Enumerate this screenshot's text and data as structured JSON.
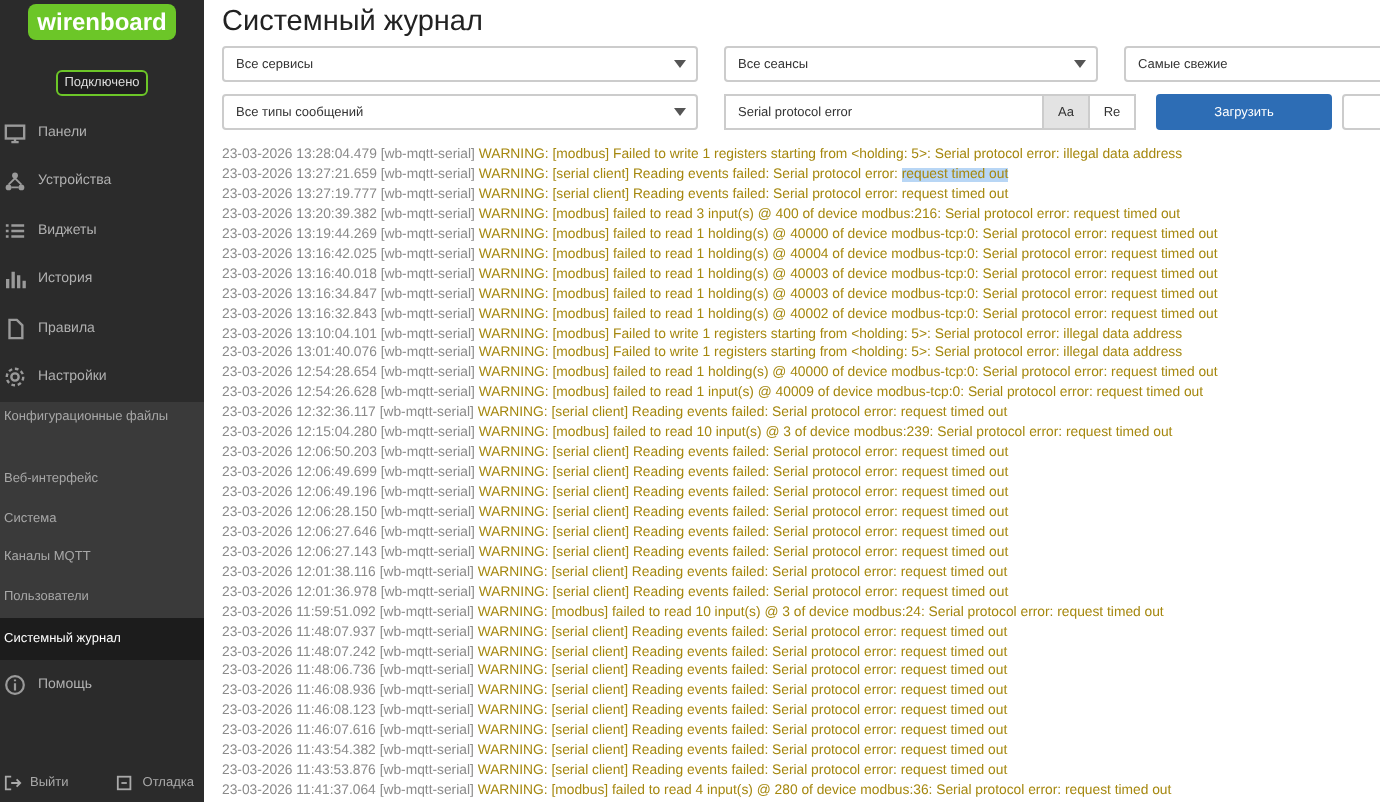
{
  "sidebar": {
    "logo": "wirenboard",
    "status": "Подключено",
    "items": [
      {
        "kind": "nav",
        "label": "Панели",
        "selected": false
      },
      {
        "kind": "nav",
        "label": "Устройства",
        "selected": false
      },
      {
        "kind": "nav",
        "label": "Виджеты",
        "selected": false
      },
      {
        "kind": "nav",
        "label": "История",
        "selected": false
      },
      {
        "kind": "nav",
        "label": "Правила",
        "selected": false
      },
      {
        "kind": "nav",
        "label": "Настройки",
        "selected": false,
        "children": [
          {
            "label": "Конфигурационные файлы",
            "selected": false
          },
          {
            "label": "Веб-интерфейс",
            "selected": false
          },
          {
            "label": "Система",
            "selected": false
          },
          {
            "label": "Каналы MQTT",
            "selected": false
          },
          {
            "label": "Пользователи",
            "selected": false
          },
          {
            "label": "Системный журнал",
            "selected": true
          }
        ]
      },
      {
        "kind": "nav",
        "label": "Помощь",
        "selected": false
      }
    ],
    "footer": [
      "Выйти",
      "Отладка"
    ]
  },
  "page": {
    "title": "Системный журнал"
  },
  "filters": {
    "service": "Все сервисы",
    "session": "Все сеансы",
    "order": "Самые свежие",
    "message_type": "Все типы сообщений",
    "search": {
      "value": "Serial protocol error"
    },
    "toggles": [
      {
        "label": "Aa",
        "selected": true
      },
      {
        "label": "Re",
        "selected": false
      }
    ],
    "load_button": "Загрузить"
  },
  "log": [
    {
      "timestamp": "23-03-2026 13:28:04.479",
      "source": "[wb-mqtt-serial]",
      "message": "WARNING: [modbus] Failed to write 1 registers starting from <holding: 5>: Serial protocol error: illegal data address"
    },
    {
      "timestamp": "23-03-2026 13:27:21.659",
      "source": "[wb-mqtt-serial]",
      "message": "WARNING: [serial client] Reading events failed: Serial protocol error: ",
      "selected_text": "request timed out"
    },
    {
      "timestamp": "23-03-2026 13:27:19.777",
      "source": "[wb-mqtt-serial]",
      "message": "WARNING: [serial client] Reading events failed: Serial protocol error: request timed out"
    },
    {
      "timestamp": "23-03-2026 13:20:39.382",
      "source": "[wb-mqtt-serial]",
      "message": "WARNING: [modbus] failed to read 3 input(s) @ 400 of device modbus:216: Serial protocol error: request timed out"
    },
    {
      "timestamp": "23-03-2026 13:19:44.269",
      "source": "[wb-mqtt-serial]",
      "message": "WARNING: [modbus] failed to read 1 holding(s) @ 40000 of device modbus-tcp:0: Serial protocol error: request timed out"
    },
    {
      "timestamp": "23-03-2026 13:16:42.025",
      "source": "[wb-mqtt-serial]",
      "message": "WARNING: [modbus] failed to read 1 holding(s) @ 40004 of device modbus-tcp:0: Serial protocol error: request timed out"
    },
    {
      "timestamp": "23-03-2026 13:16:40.018",
      "source": "[wb-mqtt-serial]",
      "message": "WARNING: [modbus] failed to read 1 holding(s) @ 40003 of device modbus-tcp:0: Serial protocol error: request timed out"
    },
    {
      "timestamp": "23-03-2026 13:16:34.847",
      "source": "[wb-mqtt-serial]",
      "message": "WARNING: [modbus] failed to read 1 holding(s) @ 40003 of device modbus-tcp:0: Serial protocol error: request timed out"
    },
    {
      "timestamp": "23-03-2026 13:16:32.843",
      "source": "[wb-mqtt-serial]",
      "message": "WARNING: [modbus] failed to read 1 holding(s) @ 40002 of device modbus-tcp:0: Serial protocol error: request timed out"
    },
    {
      "timestamp": "23-03-2026 13:10:04.101",
      "source": "[wb-mqtt-serial]",
      "message": "WARNING: [modbus] Failed to write 1 registers starting from <holding: 5>: Serial protocol error: illegal data address"
    },
    {
      "timestamp": "23-03-2026 13:01:40.076",
      "source": "[wb-mqtt-serial]",
      "message": "WARNING: [modbus] Failed to write 1 registers starting from <holding: 5>: Serial protocol error: illegal data address"
    },
    {
      "timestamp": "23-03-2026 12:54:28.654",
      "source": "[wb-mqtt-serial]",
      "message": "WARNING: [modbus] failed to read 1 holding(s) @ 40000 of device modbus-tcp:0: Serial protocol error: request timed out"
    },
    {
      "timestamp": "23-03-2026 12:54:26.628",
      "source": "[wb-mqtt-serial]",
      "message": "WARNING: [modbus] failed to read 1 input(s) @ 40009 of device modbus-tcp:0: Serial protocol error: request timed out"
    },
    {
      "timestamp": "23-03-2026 12:32:36.117",
      "source": "[wb-mqtt-serial]",
      "message": "WARNING: [serial client] Reading events failed: Serial protocol error: request timed out"
    },
    {
      "timestamp": "23-03-2026 12:15:04.280",
      "source": "[wb-mqtt-serial]",
      "message": "WARNING: [modbus] failed to read 10 input(s) @ 3 of device modbus:239: Serial protocol error: request timed out"
    },
    {
      "timestamp": "23-03-2026 12:06:50.203",
      "source": "[wb-mqtt-serial]",
      "message": "WARNING: [serial client] Reading events failed: Serial protocol error: request timed out"
    },
    {
      "timestamp": "23-03-2026 12:06:49.699",
      "source": "[wb-mqtt-serial]",
      "message": "WARNING: [serial client] Reading events failed: Serial protocol error: request timed out"
    },
    {
      "timestamp": "23-03-2026 12:06:49.196",
      "source": "[wb-mqtt-serial]",
      "message": "WARNING: [serial client] Reading events failed: Serial protocol error: request timed out"
    },
    {
      "timestamp": "23-03-2026 12:06:28.150",
      "source": "[wb-mqtt-serial]",
      "message": "WARNING: [serial client] Reading events failed: Serial protocol error: request timed out"
    },
    {
      "timestamp": "23-03-2026 12:06:27.646",
      "source": "[wb-mqtt-serial]",
      "message": "WARNING: [serial client] Reading events failed: Serial protocol error: request timed out"
    },
    {
      "timestamp": "23-03-2026 12:06:27.143",
      "source": "[wb-mqtt-serial]",
      "message": "WARNING: [serial client] Reading events failed: Serial protocol error: request timed out"
    },
    {
      "timestamp": "23-03-2026 12:01:38.116",
      "source": "[wb-mqtt-serial]",
      "message": "WARNING: [serial client] Reading events failed: Serial protocol error: request timed out"
    },
    {
      "timestamp": "23-03-2026 12:01:36.978",
      "source": "[wb-mqtt-serial]",
      "message": "WARNING: [serial client] Reading events failed: Serial protocol error: request timed out"
    },
    {
      "timestamp": "23-03-2026 11:59:51.092",
      "source": "[wb-mqtt-serial]",
      "message": "WARNING: [modbus] failed to read 10 input(s) @ 3 of device modbus:24: Serial protocol error: request timed out"
    },
    {
      "timestamp": "23-03-2026 11:48:07.937",
      "source": "[wb-mqtt-serial]",
      "message": "WARNING: [serial client] Reading events failed: Serial protocol error: request timed out"
    },
    {
      "timestamp": "23-03-2026 11:48:07.242",
      "source": "[wb-mqtt-serial]",
      "message": "WARNING: [serial client] Reading events failed: Serial protocol error: request timed out"
    },
    {
      "timestamp": "23-03-2026 11:48:06.736",
      "source": "[wb-mqtt-serial]",
      "message": "WARNING: [serial client] Reading events failed: Serial protocol error: request timed out"
    },
    {
      "timestamp": "23-03-2026 11:46:08.936",
      "source": "[wb-mqtt-serial]",
      "message": "WARNING: [serial client] Reading events failed: Serial protocol error: request timed out"
    },
    {
      "timestamp": "23-03-2026 11:46:08.123",
      "source": "[wb-mqtt-serial]",
      "message": "WARNING: [serial client] Reading events failed: Serial protocol error: request timed out"
    },
    {
      "timestamp": "23-03-2026 11:46:07.616",
      "source": "[wb-mqtt-serial]",
      "message": "WARNING: [serial client] Reading events failed: Serial protocol error: request timed out"
    },
    {
      "timestamp": "23-03-2026 11:43:54.382",
      "source": "[wb-mqtt-serial]",
      "message": "WARNING: [serial client] Reading events failed: Serial protocol error: request timed out"
    },
    {
      "timestamp": "23-03-2026 11:43:53.876",
      "source": "[wb-mqtt-serial]",
      "message": "WARNING: [serial client] Reading events failed: Serial protocol error: request timed out"
    },
    {
      "timestamp": "23-03-2026 11:41:37.064",
      "source": "[wb-mqtt-serial]",
      "message": "WARNING: [modbus] failed to read 4 input(s) @ 280 of device modbus:36: Serial protocol error: request timed out"
    }
  ]
}
